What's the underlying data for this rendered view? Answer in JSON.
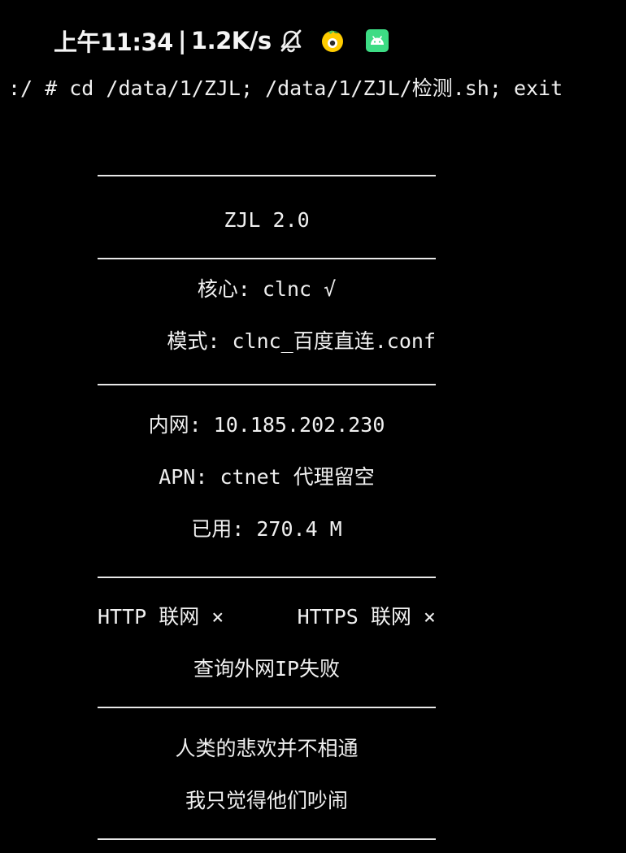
{
  "status_bar": {
    "time": "上午11:34",
    "separator": "|",
    "network_speed": "1.2K/s",
    "icons": [
      "bell-muted-icon",
      "qq-icon",
      "android-icon"
    ],
    "android_icon_color": "#3ddc84",
    "qq_icon_color": "#ffcc00"
  },
  "terminal": {
    "command": ":/ # cd /data/1/ZJL; /data/1/ZJL/检测.sh; exit",
    "title": "ZJL 2.0",
    "core": "核心: clnc √",
    "mode": "模式: clnc_百度直连.conf",
    "intranet": "内网: 10.185.202.230",
    "apn": "APN: ctnet 代理留空",
    "used": "已用: 270.4 M",
    "http_status": "HTTP 联网 ×",
    "https_status": "HTTPS 联网 ×",
    "ip_query": "查询外网IP失败",
    "quote_line1": "人类的悲欢并不相通",
    "quote_line2": "我只觉得他们吵闹"
  }
}
